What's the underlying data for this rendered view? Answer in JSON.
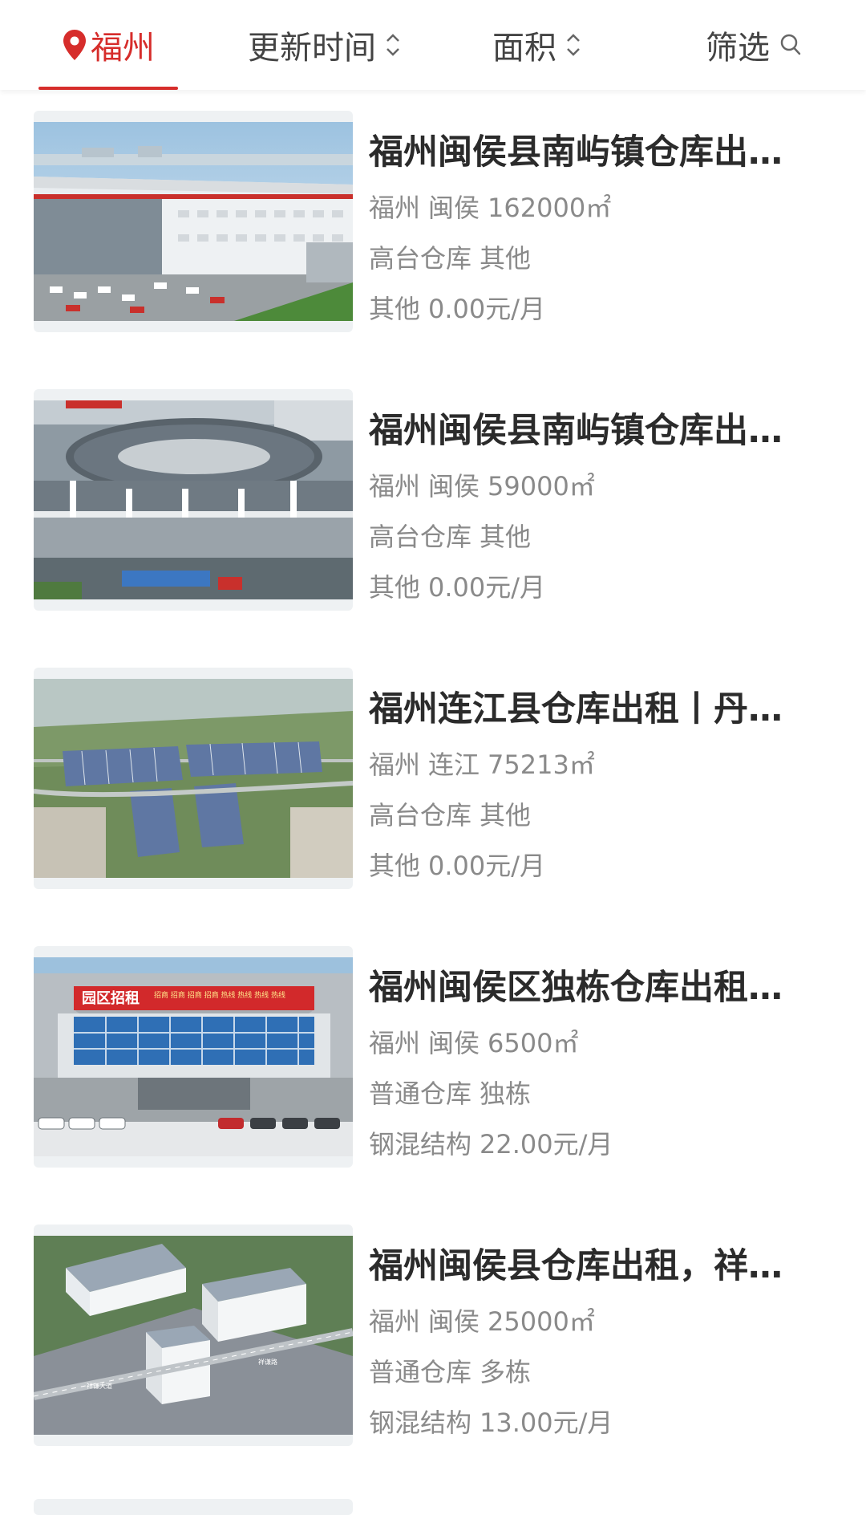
{
  "tabs": {
    "city": "福州",
    "time": "更新时间",
    "area": "面积",
    "filter": "筛选"
  },
  "colors": {
    "accent": "#d62d2b"
  },
  "listings": [
    {
      "title": "福州闽侯县南屿镇仓库出…",
      "city": "福州",
      "district": "闽侯",
      "area": "162000㎡",
      "warehouse_type": "高台仓库",
      "structure_type": "其他",
      "structure": "其他",
      "price": "0.00元/月"
    },
    {
      "title": "福州闽侯县南屿镇仓库出…",
      "city": "福州",
      "district": "闽侯",
      "area": "59000㎡",
      "warehouse_type": "高台仓库",
      "structure_type": "其他",
      "structure": "其他",
      "price": "0.00元/月"
    },
    {
      "title": "福州连江县仓库出租丨丹…",
      "city": "福州",
      "district": "连江",
      "area": "75213㎡",
      "warehouse_type": "高台仓库",
      "structure_type": "其他",
      "structure": "其他",
      "price": "0.00元/月"
    },
    {
      "title": "福州闽侯区独栋仓库出租…",
      "city": "福州",
      "district": "闽侯",
      "area": "6500㎡",
      "warehouse_type": "普通仓库",
      "structure_type": "独栋",
      "structure": "钢混结构",
      "price": "22.00元/月"
    },
    {
      "title": "福州闽侯县仓库出租，祥…",
      "city": "福州",
      "district": "闽侯",
      "area": "25000㎡",
      "warehouse_type": "普通仓库",
      "structure_type": "多栋",
      "structure": "钢混结构",
      "price": "13.00元/月"
    }
  ],
  "image_texts": {
    "banner_main": "园区招租",
    "banner_small": "招商 招商 招商 招商 热线 热线 热线 热线",
    "road_1": "祥谦大道",
    "road_2": "祥谦路"
  },
  "icons": {
    "city": "location-pin-icon",
    "sort": "sort-updown-icon",
    "filter": "search-icon"
  }
}
